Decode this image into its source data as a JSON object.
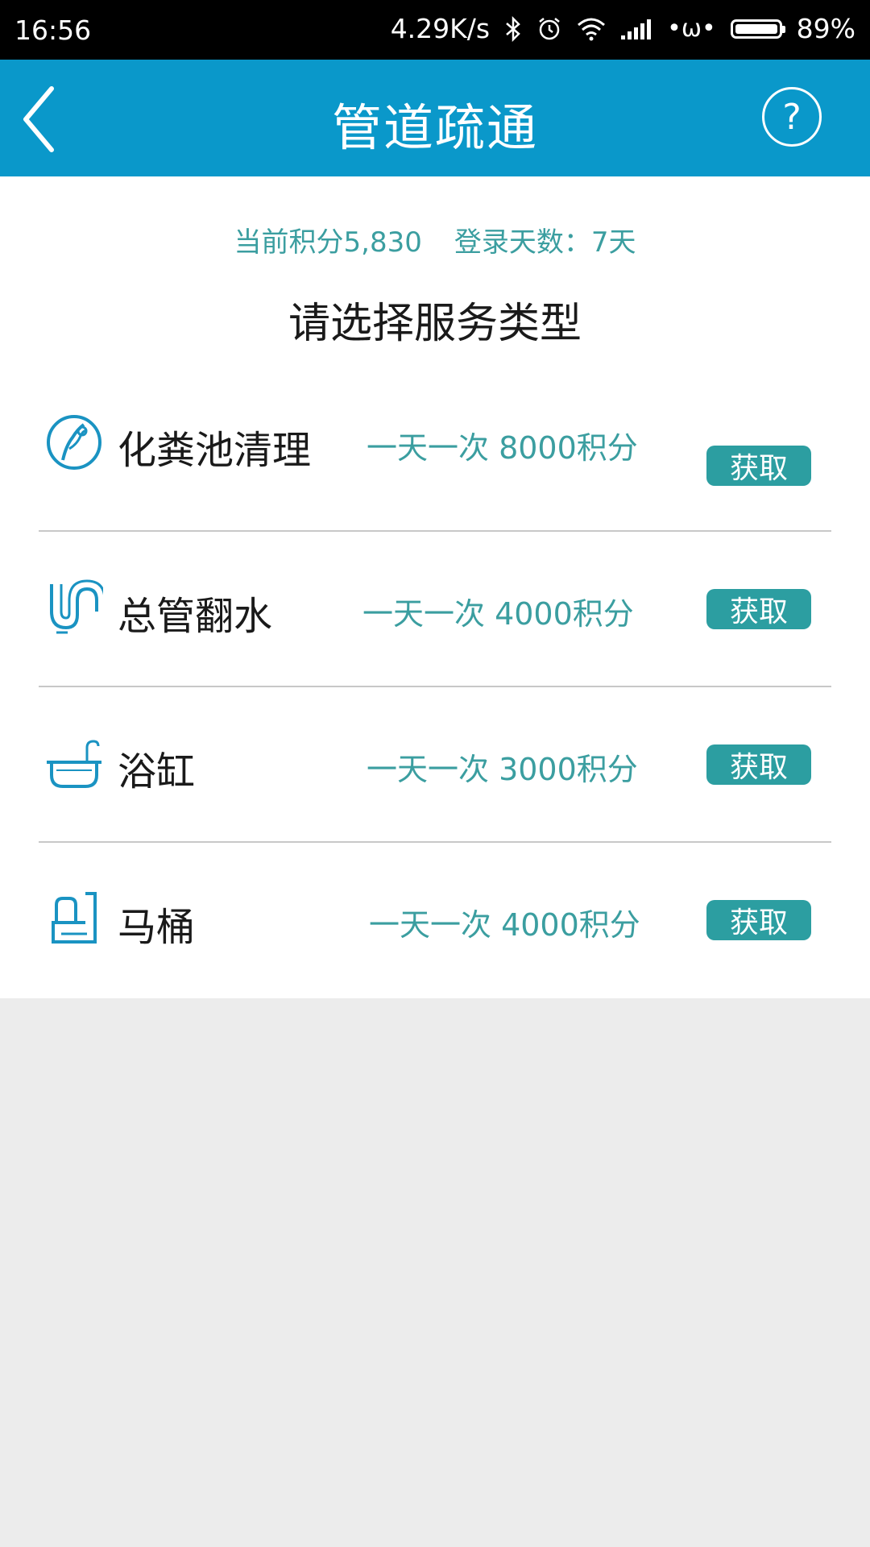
{
  "status_bar": {
    "time": "16:56",
    "net_speed": "4.29K/s",
    "battery_text": "89%"
  },
  "header": {
    "title": "管道疏通",
    "help_label": "?"
  },
  "summary": {
    "points": "当前积分5,830",
    "login_days": "登录天数：7天"
  },
  "prompt": "请选择服务类型",
  "services": [
    {
      "name": "化粪池清理",
      "desc": "一天一次 8000积分",
      "button": "获取",
      "icon": "septic-tank-icon"
    },
    {
      "name": "总管翻水",
      "desc": "一天一次 4000积分",
      "button": "获取",
      "icon": "pipe-icon"
    },
    {
      "name": "浴缸",
      "desc": "一天一次 3000积分",
      "button": "获取",
      "icon": "bathtub-icon"
    },
    {
      "name": "马桶",
      "desc": "一天一次 4000积分",
      "button": "获取",
      "icon": "toilet-icon"
    }
  ],
  "colors": {
    "header_bg": "#0a98ca",
    "accent_teal": "#2c9ea1",
    "text_teal": "#3b9ea0",
    "page_bg": "#ececec"
  }
}
